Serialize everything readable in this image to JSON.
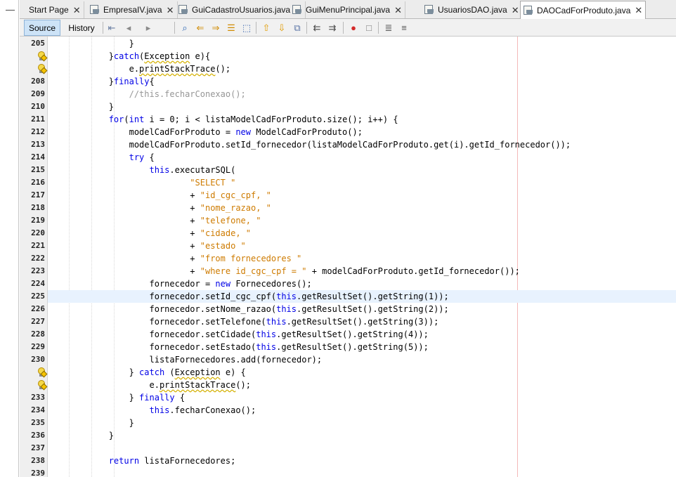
{
  "left_strip": {
    "dash": "—"
  },
  "tabs": [
    {
      "label": "Start Page",
      "icon": "none",
      "active": false
    },
    {
      "label": "EmpresaIV.java",
      "icon": "java-file-icon",
      "active": false
    },
    {
      "label": "GuiCadastroUsuarios.java",
      "icon": "java-file-icon",
      "active": false
    },
    {
      "label": "GuiMenuPrincipal.java",
      "icon": "java-file-icon",
      "active": false
    },
    {
      "label": "UsuariosDAO.java",
      "icon": "java-file-icon",
      "active": false
    },
    {
      "label": "DAOCadForProduto.java",
      "icon": "java-file-icon",
      "active": true
    }
  ],
  "close_glyph": "✕",
  "toolbar": {
    "source_label": "Source",
    "history_label": "History",
    "buttons": [
      {
        "name": "last-edit-icon",
        "glyph": "⇤",
        "color": "#6a7fa4"
      },
      {
        "name": "back-icon",
        "glyph": "◂",
        "color": "#8a8a8a"
      },
      {
        "name": "forward-icon",
        "glyph": "▸",
        "color": "#8a8a8a"
      },
      {
        "name": "find-icon",
        "glyph": "⌕",
        "color": "#2c67b5"
      },
      {
        "name": "find-previous-icon",
        "glyph": "⇐",
        "color": "#d08a00"
      },
      {
        "name": "find-next-icon",
        "glyph": "⇒",
        "color": "#d08a00"
      },
      {
        "name": "find-selection-icon",
        "glyph": "☰",
        "color": "#d08a00"
      },
      {
        "name": "toggle-rect-selection-icon",
        "glyph": "⬚",
        "color": "#3d68b0"
      },
      {
        "name": "previous-bookmark-icon",
        "glyph": "⇧",
        "color": "#e19b00"
      },
      {
        "name": "next-bookmark-icon",
        "glyph": "⇩",
        "color": "#e19b00"
      },
      {
        "name": "toggle-bookmark-icon",
        "glyph": "⧉",
        "color": "#5b75a6"
      },
      {
        "name": "shift-left-icon",
        "glyph": "⇇",
        "color": "#4a4a4a"
      },
      {
        "name": "shift-right-icon",
        "glyph": "⇉",
        "color": "#4a4a4a"
      },
      {
        "name": "start-macro-icon",
        "glyph": "●",
        "color": "#d42a2a"
      },
      {
        "name": "stop-macro-icon",
        "glyph": "□",
        "color": "#7a7a7a"
      },
      {
        "name": "comment-icon",
        "glyph": "≣",
        "color": "#555555"
      },
      {
        "name": "uncomment-icon",
        "glyph": "≡",
        "color": "#555555"
      }
    ]
  },
  "editor": {
    "colors": {
      "keyword": "#0000e6",
      "string": "#ce7b00",
      "comment": "#969696",
      "current_line": "#e8f2fe"
    },
    "lines": [
      {
        "n": "205",
        "bulb": false,
        "current": false,
        "parts": [
          [
            "p",
            "                }"
          ]
        ]
      },
      {
        "n": "",
        "bulb": true,
        "current": false,
        "parts": [
          [
            "p",
            "            }"
          ],
          [
            "k",
            "catch"
          ],
          [
            "p",
            "("
          ],
          [
            "e",
            "Exception"
          ],
          [
            "p",
            " e){"
          ]
        ]
      },
      {
        "n": "",
        "bulb": true,
        "current": false,
        "parts": [
          [
            "p",
            "                e."
          ],
          [
            "e",
            "printStackTrace"
          ],
          [
            "p",
            "();"
          ]
        ]
      },
      {
        "n": "208",
        "bulb": false,
        "current": false,
        "parts": [
          [
            "p",
            "            }"
          ],
          [
            "k",
            "finally"
          ],
          [
            "p",
            "{"
          ]
        ]
      },
      {
        "n": "209",
        "bulb": false,
        "current": false,
        "parts": [
          [
            "c",
            "                //this.fecharConexao();"
          ]
        ]
      },
      {
        "n": "210",
        "bulb": false,
        "current": false,
        "parts": [
          [
            "p",
            "            }"
          ]
        ]
      },
      {
        "n": "211",
        "bulb": false,
        "current": false,
        "parts": [
          [
            "p",
            "            "
          ],
          [
            "k",
            "for"
          ],
          [
            "p",
            "("
          ],
          [
            "k",
            "int"
          ],
          [
            "p",
            " i = 0; i < listaModelCadForProduto.size(); i++) {"
          ]
        ]
      },
      {
        "n": "212",
        "bulb": false,
        "current": false,
        "parts": [
          [
            "p",
            "                modelCadForProduto = "
          ],
          [
            "k",
            "new"
          ],
          [
            "p",
            " ModelCadForProduto();"
          ]
        ]
      },
      {
        "n": "213",
        "bulb": false,
        "current": false,
        "parts": [
          [
            "p",
            "                modelCadForProduto.setId_fornecedor(listaModelCadForProduto.get(i).getId_fornecedor());"
          ]
        ]
      },
      {
        "n": "214",
        "bulb": false,
        "current": false,
        "parts": [
          [
            "p",
            "                "
          ],
          [
            "k",
            "try"
          ],
          [
            "p",
            " {"
          ]
        ]
      },
      {
        "n": "215",
        "bulb": false,
        "current": false,
        "parts": [
          [
            "p",
            "                    "
          ],
          [
            "k",
            "this"
          ],
          [
            "p",
            ".executarSQL("
          ]
        ]
      },
      {
        "n": "216",
        "bulb": false,
        "current": false,
        "parts": [
          [
            "p",
            "                            "
          ],
          [
            "s",
            "\"SELECT \""
          ]
        ]
      },
      {
        "n": "217",
        "bulb": false,
        "current": false,
        "parts": [
          [
            "p",
            "                            + "
          ],
          [
            "s",
            "\"id_cgc_cpf, \""
          ]
        ]
      },
      {
        "n": "218",
        "bulb": false,
        "current": false,
        "parts": [
          [
            "p",
            "                            + "
          ],
          [
            "s",
            "\"nome_razao, \""
          ]
        ]
      },
      {
        "n": "219",
        "bulb": false,
        "current": false,
        "parts": [
          [
            "p",
            "                            + "
          ],
          [
            "s",
            "\"telefone, \""
          ]
        ]
      },
      {
        "n": "220",
        "bulb": false,
        "current": false,
        "parts": [
          [
            "p",
            "                            + "
          ],
          [
            "s",
            "\"cidade, \""
          ]
        ]
      },
      {
        "n": "221",
        "bulb": false,
        "current": false,
        "parts": [
          [
            "p",
            "                            + "
          ],
          [
            "s",
            "\"estado \""
          ]
        ]
      },
      {
        "n": "222",
        "bulb": false,
        "current": false,
        "parts": [
          [
            "p",
            "                            + "
          ],
          [
            "s",
            "\"from fornecedores \""
          ]
        ]
      },
      {
        "n": "223",
        "bulb": false,
        "current": false,
        "parts": [
          [
            "p",
            "                            + "
          ],
          [
            "s",
            "\"where id_cgc_cpf = \""
          ],
          [
            "p",
            " + modelCadForProduto.getId_fornecedor());"
          ]
        ]
      },
      {
        "n": "224",
        "bulb": false,
        "current": false,
        "parts": [
          [
            "p",
            "                    fornecedor = "
          ],
          [
            "k",
            "new"
          ],
          [
            "p",
            " Fornecedores();"
          ]
        ]
      },
      {
        "n": "225",
        "bulb": false,
        "current": true,
        "parts": [
          [
            "p",
            "                    fornecedor.setId_cgc_cpf("
          ],
          [
            "k",
            "this"
          ],
          [
            "p",
            ".getResultSet().getString(1));"
          ]
        ]
      },
      {
        "n": "226",
        "bulb": false,
        "current": false,
        "parts": [
          [
            "p",
            "                    fornecedor.setNome_razao("
          ],
          [
            "k",
            "this"
          ],
          [
            "p",
            ".getResultSet().getString(2));"
          ]
        ]
      },
      {
        "n": "227",
        "bulb": false,
        "current": false,
        "parts": [
          [
            "p",
            "                    fornecedor.setTelefone("
          ],
          [
            "k",
            "this"
          ],
          [
            "p",
            ".getResultSet().getString(3));"
          ]
        ]
      },
      {
        "n": "228",
        "bulb": false,
        "current": false,
        "parts": [
          [
            "p",
            "                    fornecedor.setCidade("
          ],
          [
            "k",
            "this"
          ],
          [
            "p",
            ".getResultSet().getString(4));"
          ]
        ]
      },
      {
        "n": "229",
        "bulb": false,
        "current": false,
        "parts": [
          [
            "p",
            "                    fornecedor.setEstado("
          ],
          [
            "k",
            "this"
          ],
          [
            "p",
            ".getResultSet().getString(5));"
          ]
        ]
      },
      {
        "n": "230",
        "bulb": false,
        "current": false,
        "parts": [
          [
            "p",
            "                    listaFornecedores.add(fornecedor);"
          ]
        ]
      },
      {
        "n": "",
        "bulb": true,
        "current": false,
        "parts": [
          [
            "p",
            "                } "
          ],
          [
            "k",
            "catch"
          ],
          [
            "p",
            " ("
          ],
          [
            "e",
            "Exception"
          ],
          [
            "p",
            " e) {"
          ]
        ]
      },
      {
        "n": "",
        "bulb": true,
        "current": false,
        "parts": [
          [
            "p",
            "                    e."
          ],
          [
            "e",
            "printStackTrace"
          ],
          [
            "p",
            "();"
          ]
        ]
      },
      {
        "n": "233",
        "bulb": false,
        "current": false,
        "parts": [
          [
            "p",
            "                } "
          ],
          [
            "k",
            "finally"
          ],
          [
            "p",
            " {"
          ]
        ]
      },
      {
        "n": "234",
        "bulb": false,
        "current": false,
        "parts": [
          [
            "p",
            "                    "
          ],
          [
            "k",
            "this"
          ],
          [
            "p",
            ".fecharConexao();"
          ]
        ]
      },
      {
        "n": "235",
        "bulb": false,
        "current": false,
        "parts": [
          [
            "p",
            "                }"
          ]
        ]
      },
      {
        "n": "236",
        "bulb": false,
        "current": false,
        "parts": [
          [
            "p",
            "            }"
          ]
        ]
      },
      {
        "n": "237",
        "bulb": false,
        "current": false,
        "parts": [
          [
            "p",
            ""
          ]
        ]
      },
      {
        "n": "238",
        "bulb": false,
        "current": false,
        "parts": [
          [
            "p",
            "            "
          ],
          [
            "k",
            "return"
          ],
          [
            "p",
            " listaFornecedores;"
          ]
        ]
      },
      {
        "n": "239",
        "bulb": false,
        "current": false,
        "parts": [
          [
            "p",
            ""
          ]
        ]
      }
    ]
  }
}
